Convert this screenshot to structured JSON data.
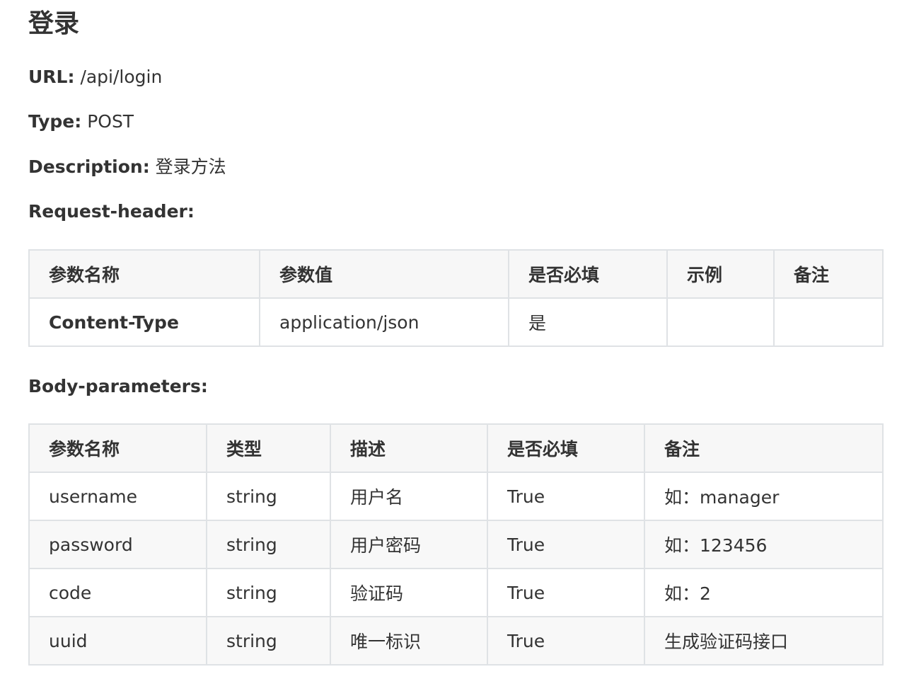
{
  "title": "登录",
  "fields": {
    "url_label": "URL:",
    "url_value": "/api/login",
    "type_label": "Type:",
    "type_value": "POST",
    "desc_label": "Description:",
    "desc_value": "登录方法",
    "req_header_label": "Request-header:",
    "body_params_label": "Body-parameters:"
  },
  "header_table": {
    "columns": [
      "参数名称",
      "参数值",
      "是否必填",
      "示例",
      "备注"
    ],
    "rows": [
      [
        "Content-Type",
        "application/json",
        "是",
        "",
        ""
      ]
    ]
  },
  "body_table": {
    "columns": [
      "参数名称",
      "类型",
      "描述",
      "是否必填",
      "备注"
    ],
    "rows": [
      [
        "username",
        "string",
        "用户名",
        "True",
        "如：manager"
      ],
      [
        "password",
        "string",
        "用户密码",
        "True",
        "如：123456"
      ],
      [
        "code",
        "string",
        "验证码",
        "True",
        "如：2"
      ],
      [
        "uuid",
        "string",
        "唯一标识",
        "True",
        "生成验证码接口"
      ]
    ]
  }
}
